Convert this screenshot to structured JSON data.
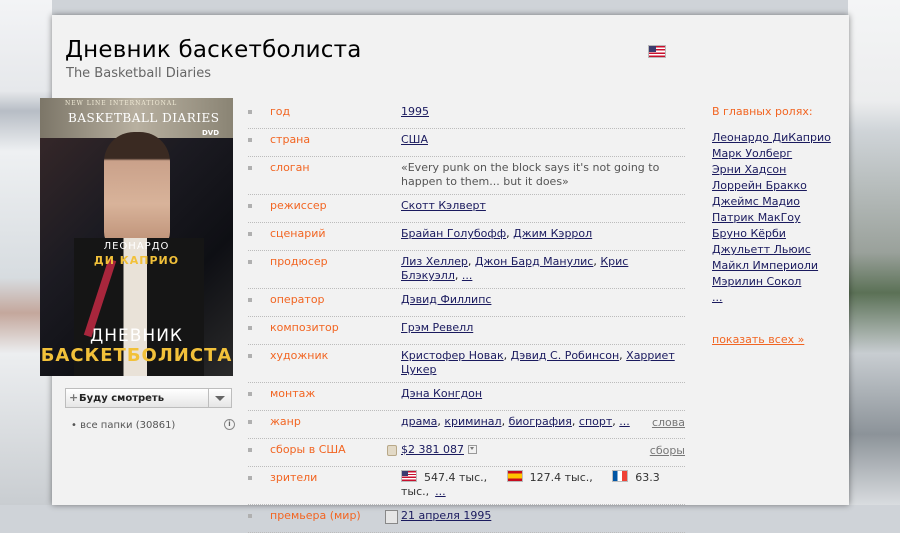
{
  "film": {
    "title_ru": "Дневник баскетболиста",
    "title_orig": "The Basketball Diaries"
  },
  "poster": {
    "studio": "NEW LINE INTERNATIONAL",
    "film_en": "BASKETBALL DIARIES",
    "dvd_mark": "DVD",
    "actor_first": "ЛЕОНАРДО",
    "actor_last": "ДИ КАПРИО",
    "title_line1": "ДНЕВНИК",
    "title_line2": "БАСКЕТБОЛИСТА"
  },
  "watch_button": {
    "label": "Буду смотреть"
  },
  "folders": {
    "label": "• все папки (30861)"
  },
  "info": {
    "year": {
      "label": "год",
      "value": "1995"
    },
    "country": {
      "label": "страна",
      "value": "США"
    },
    "slogan": {
      "label": "слоган",
      "value": "«Every punk on the block says it's not going to happen to them... but it does»"
    },
    "director": {
      "label": "режиссер",
      "value": "Скотт Кэлверт"
    },
    "script": {
      "label": "сценарий",
      "v1": "Брайан Голубофф",
      "v2": "Джим Кэррол"
    },
    "producer": {
      "label": "продюсер",
      "v1": "Лиз Хеллер",
      "v2": "Джон Бард Манулис",
      "v3": "Крис Блэкуэлл",
      "more": "..."
    },
    "operator": {
      "label": "оператор",
      "value": "Дэвид Филлипс"
    },
    "composer": {
      "label": "композитор",
      "value": "Грэм Ревелл"
    },
    "artist": {
      "label": "художник",
      "v1": "Кристофер Новак",
      "v2": "Дэвид С. Робинсон",
      "v3": "Харриет Цукер"
    },
    "editing": {
      "label": "монтаж",
      "value": "Дэна Конгдон"
    },
    "genre": {
      "label": "жанр",
      "v1": "драма",
      "v2": "криминал",
      "v3": "биография",
      "v4": "спорт",
      "more": "...",
      "side": "слова"
    },
    "box_office": {
      "label": "сборы в США",
      "value": "$2 381 087",
      "side": "сборы"
    },
    "viewers": {
      "label": "зрители",
      "us": "547.4 тыс.,",
      "es": "127.4 тыс.,",
      "fr": "63.3 тыс.,",
      "more": "..."
    },
    "premiere": {
      "label": "премьера (мир)",
      "value": "21 апреля 1995"
    }
  },
  "cast": {
    "title": "В главных ролях:",
    "actors": [
      "Леонардо ДиКаприо",
      "Марк Уолберг",
      "Эрни Хадсон",
      "Лоррейн Бракко",
      "Джеймс Мадио",
      "Патрик МакГоу",
      "Бруно Кёрби",
      "Джульетт Льюис",
      "Майкл Империоли",
      "Мэрилин Сокол"
    ],
    "more": "...",
    "show_all": "показать всех »"
  }
}
